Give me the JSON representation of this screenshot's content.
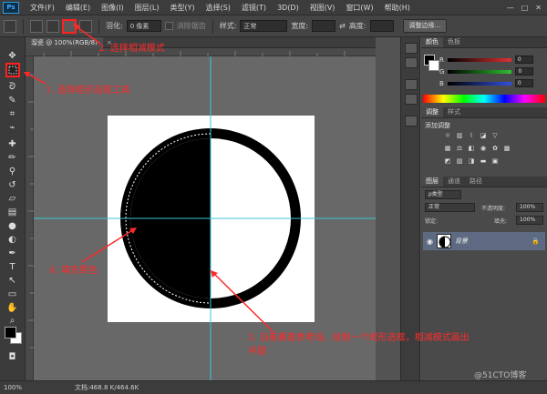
{
  "app": {
    "logo": "Ps"
  },
  "menu": [
    "文件(F)",
    "编辑(E)",
    "图像(I)",
    "图层(L)",
    "类型(Y)",
    "选择(S)",
    "滤镜(T)",
    "3D(D)",
    "视图(V)",
    "窗口(W)",
    "帮助(H)"
  ],
  "window_controls": [
    "—",
    "□",
    "✕"
  ],
  "options": {
    "feather_label": "羽化:",
    "feather_value": "0 像素",
    "antialias_label": "消除锯齿",
    "style_label": "样式:",
    "style_value": "正常",
    "width_label": "宽度:",
    "height_label": "高度:",
    "refine_button": "调整边缘..."
  },
  "document": {
    "tab_name": "溜瓷 @ 100%(RGB/8)",
    "close": "×"
  },
  "status": {
    "zoom": "100%",
    "doc_size": "文档:468.8 K/464.6K"
  },
  "color_panel": {
    "tabs": [
      "颜色",
      "色板"
    ],
    "channels": [
      {
        "label": "R",
        "value": "0",
        "color": "#e03030"
      },
      {
        "label": "G",
        "value": "0",
        "color": "#30c030"
      },
      {
        "label": "B",
        "value": "0",
        "color": "#3050e0"
      }
    ]
  },
  "adjust_panel": {
    "tabs": [
      "调整",
      "样式"
    ],
    "title": "添加调整"
  },
  "layers_panel": {
    "tabs": [
      "图层",
      "通道",
      "路径"
    ],
    "kind_label": "ρ类型",
    "blend_mode": "正常",
    "opacity_label": "不透明度:",
    "opacity_value": "100%",
    "lock_label": "锁定:",
    "fill_label": "填充:",
    "fill_value": "100%",
    "layers": [
      {
        "name": "背景",
        "locked": true
      }
    ]
  },
  "annotations": {
    "step1": "1. 选择矩形选框工具",
    "step2": "2. 选择相减模式",
    "step3a": "3. 沿着垂直参考线，绘制一个矩形选框，相减模式画出",
    "step3b": "半圆",
    "step4": "4. 填充黑色"
  },
  "watermark": "@51CTO博客",
  "colors": {
    "accent": "#ff2a2a",
    "guide": "#3cc7d6",
    "layer_selected": "#5d6a82"
  }
}
